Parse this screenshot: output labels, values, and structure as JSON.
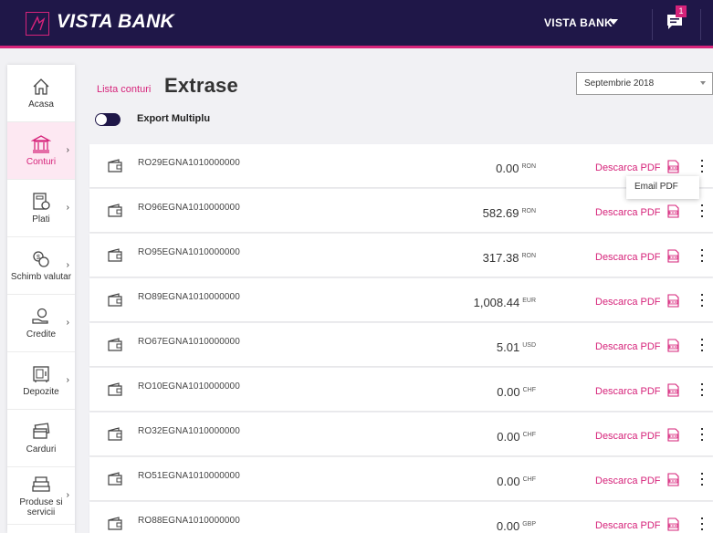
{
  "header": {
    "logo_text": "VISTA BANK",
    "bank_selector": "VISTA BANK",
    "notification_count": "1",
    "accent_color": "#d6237a",
    "bar_color": "#1f1748"
  },
  "sidebar": {
    "items": [
      {
        "label": "Acasa",
        "icon": "home-icon"
      },
      {
        "label": "Conturi",
        "icon": "bank-icon",
        "active": true
      },
      {
        "label": "Plati",
        "icon": "payment-icon"
      },
      {
        "label": "Schimb valutar",
        "icon": "exchange-icon"
      },
      {
        "label": "Credite",
        "icon": "credit-icon"
      },
      {
        "label": "Depozite",
        "icon": "safe-icon"
      },
      {
        "label": "Carduri",
        "icon": "card-icon"
      },
      {
        "label": "Produse si servicii",
        "icon": "products-icon"
      }
    ]
  },
  "main": {
    "breadcrumb": "Lista conturi",
    "title": "Extrase",
    "month": "Septembrie 2018",
    "export_label": "Export Multiplu",
    "pdf_label": "Descarca PDF",
    "email_pdf": "Email PDF"
  },
  "accounts": [
    {
      "iban": "RO29EGNA1010000000",
      "amount": "0.00",
      "currency": "RON"
    },
    {
      "iban": "RO96EGNA1010000000",
      "amount": "582.69",
      "currency": "RON"
    },
    {
      "iban": "RO95EGNA1010000000",
      "amount": "317.38",
      "currency": "RON"
    },
    {
      "iban": "RO89EGNA1010000000",
      "amount": "1,008.44",
      "currency": "EUR"
    },
    {
      "iban": "RO67EGNA1010000000",
      "amount": "5.01",
      "currency": "USD"
    },
    {
      "iban": "RO10EGNA1010000000",
      "amount": "0.00",
      "currency": "CHF"
    },
    {
      "iban": "RO32EGNA1010000000",
      "amount": "0.00",
      "currency": "CHF"
    },
    {
      "iban": "RO51EGNA1010000000",
      "amount": "0.00",
      "currency": "CHF"
    },
    {
      "iban": "RO88EGNA1010000000",
      "amount": "0.00",
      "currency": "GBP"
    }
  ]
}
